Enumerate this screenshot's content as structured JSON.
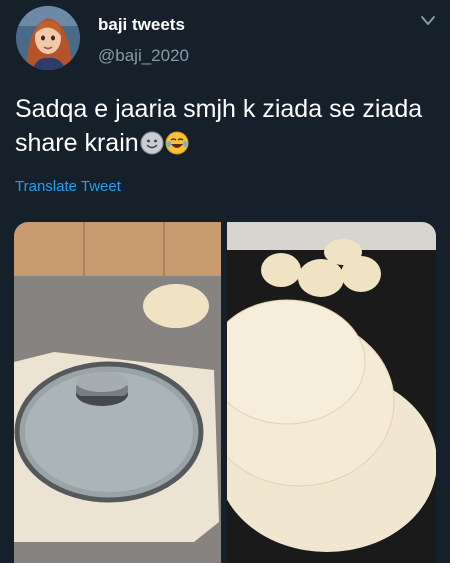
{
  "header": {
    "display_name": "baji tweets",
    "handle": "@baji_2020",
    "avatar_icon": "profile-avatar",
    "menu_icon": "chevron-down-icon"
  },
  "tweet": {
    "text": "Sadqa e jaaria smjh k ziada se ziada share krain",
    "emojis": [
      "slightly-smiling-face-icon",
      "laughing-tears-face-icon"
    ],
    "translate_label": "Translate Tweet"
  },
  "media": {
    "images": [
      "photo-dough-and-pot-lid",
      "photo-rolled-dough-circles"
    ]
  },
  "colors": {
    "background": "#15202b",
    "secondary_text": "#8899a6",
    "link": "#1da1f2"
  }
}
